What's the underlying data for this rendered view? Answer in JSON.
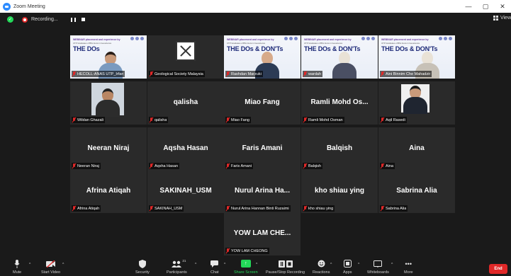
{
  "window": {
    "title": "Zoom Meeting",
    "minimize": "—",
    "maximize": "▢",
    "close": "✕"
  },
  "topbar": {
    "recording_label": "Recording...",
    "view_label": "View"
  },
  "colors": {
    "accent_green": "#23d959",
    "active_border": "#b5e35c",
    "end_red": "#e02828",
    "tile_bg": "#2a2a2a",
    "slide_title": "#1e2a78"
  },
  "slide": {
    "heading": "WEBINAR placement and experience by",
    "subheading": "UTP Graduates of BSc Hons in Geoscience",
    "title": "THE DOs & DON'Ts",
    "title_short": "THE DOs"
  },
  "tiles": [
    {
      "id": "t1",
      "big_name": "",
      "label": "HECOLL-ANAS UTP_Irfan",
      "video": "slide",
      "active": true
    },
    {
      "id": "t2",
      "big_name": "",
      "label": "Geological Society Malaysia",
      "video": "logo",
      "active": false
    },
    {
      "id": "t3",
      "big_name": "",
      "label": "Rashdan Marzuki",
      "video": "slide",
      "active": false
    },
    {
      "id": "t4",
      "big_name": "",
      "label": "wardah",
      "video": "slide",
      "active": false
    },
    {
      "id": "t5",
      "big_name": "",
      "label": "Aini Binnim Che Mahadzir",
      "video": "slide",
      "active": false
    },
    {
      "id": "t6",
      "big_name": "",
      "label": "Wildan Ghazali",
      "video": "camera",
      "active": false
    },
    {
      "id": "t7",
      "big_name": "qalisha",
      "label": "qalisha",
      "video": "none",
      "active": false
    },
    {
      "id": "t8",
      "big_name": "Miao Fang",
      "label": "Miao Fang",
      "video": "none",
      "active": false
    },
    {
      "id": "t9",
      "big_name": "Ramli Mohd Os...",
      "label": "Ramli Mohd Osman",
      "video": "none",
      "active": false
    },
    {
      "id": "t10",
      "big_name": "",
      "label": "Aqil Rasedi",
      "video": "portrait",
      "active": false
    },
    {
      "id": "t11",
      "big_name": "Neeran Niraj",
      "label": "Neeran Niraj",
      "video": "none",
      "active": false
    },
    {
      "id": "t12",
      "big_name": "Aqsha Hasan",
      "label": "Aqsha Hasan",
      "video": "none",
      "active": false
    },
    {
      "id": "t13",
      "big_name": "Faris Amani",
      "label": "Faris Amani",
      "video": "none",
      "active": false
    },
    {
      "id": "t14",
      "big_name": "Balqish",
      "label": "Balqish",
      "video": "none",
      "active": false
    },
    {
      "id": "t15",
      "big_name": "Aina",
      "label": "Aina",
      "video": "none",
      "active": false
    },
    {
      "id": "t16",
      "big_name": "Afrina Atiqah",
      "label": "Afrina Atiqah",
      "video": "none",
      "active": false
    },
    {
      "id": "t17",
      "big_name": "SAKINAH_USM",
      "label": "SAKINAH_USM",
      "video": "none",
      "active": false
    },
    {
      "id": "t18",
      "big_name": "Nurul Arina Ha...",
      "label": "Nurul Arina Hannan Binti Ruzaimi",
      "video": "none",
      "active": false
    },
    {
      "id": "t19",
      "big_name": "kho shiau ying",
      "label": "kho shiau ying",
      "video": "none",
      "active": false
    },
    {
      "id": "t20",
      "big_name": "Sabrina Alia",
      "label": "Sabrina Alia",
      "video": "none",
      "active": false
    },
    {
      "id": "t21",
      "big_name": "YOW LAM CHE...",
      "label": "YOW LAM CHEONG",
      "video": "none",
      "active": false
    }
  ],
  "toolbar": {
    "mute": "Mute",
    "start_video": "Start Video",
    "security": "Security",
    "participants": "Participants",
    "participants_count": "21",
    "chat": "Chat",
    "share_screen": "Share Screen",
    "pause_stop_recording": "Pause/Stop Recording",
    "reactions": "Reactions",
    "apps": "Apps",
    "whiteboards": "Whiteboards",
    "more": "More",
    "end": "End"
  }
}
